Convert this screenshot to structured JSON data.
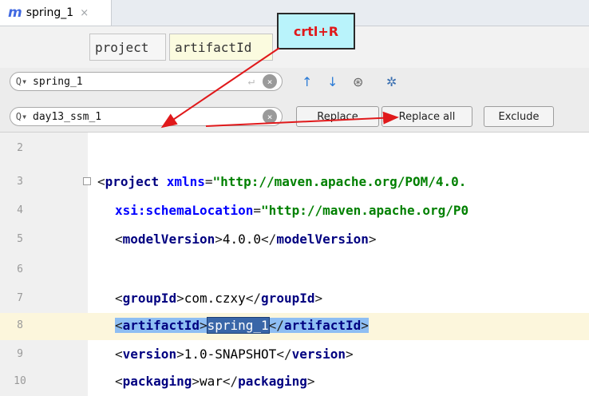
{
  "tab": {
    "icon": "m",
    "title": "spring_1",
    "close": "×"
  },
  "chips": {
    "project": "project",
    "artifact": "artifactId"
  },
  "callout": "crtl+R",
  "find": {
    "value": "spring_1",
    "enter_glyph": "↵",
    "clear_glyph": "×"
  },
  "replace_field": {
    "value": "day13_ssm_1",
    "clear_glyph": "×"
  },
  "toolbar_icons": {
    "prev": "↑",
    "next": "↓",
    "all": "⊛",
    "settings": "✲"
  },
  "buttons": {
    "replace": "Replace",
    "replace_all": "Replace all",
    "exclude": "Exclude"
  },
  "lines": [
    {
      "n": "2"
    },
    {
      "n": "3"
    },
    {
      "n": "4"
    },
    {
      "n": "5"
    },
    {
      "n": "6"
    },
    {
      "n": "7"
    },
    {
      "n": "8"
    },
    {
      "n": "9"
    },
    {
      "n": "10"
    }
  ],
  "code": {
    "l3_tag": "project",
    "l3_attr": "xmlns",
    "l3_val": "\"http://maven.apache.org/POM/4.0.",
    "l4_attr": "xsi:schemaLocation",
    "l4_val": "\"http://maven.apache.org/P0",
    "l5_tag": "modelVersion",
    "l5_text": "4.0.0",
    "l7_tag": "groupId",
    "l7_text": "com.czxy",
    "l8_tag": "artifactId",
    "l8_text": "spring_1",
    "l9_tag": "version",
    "l9_text": "1.0-SNAPSHOT",
    "l10_tag": "packaging",
    "l10_text": "war"
  },
  "colors": {
    "annotation": "#e0191b",
    "callout_bg": "#b9f3fb",
    "selection": "#8ebef3"
  }
}
